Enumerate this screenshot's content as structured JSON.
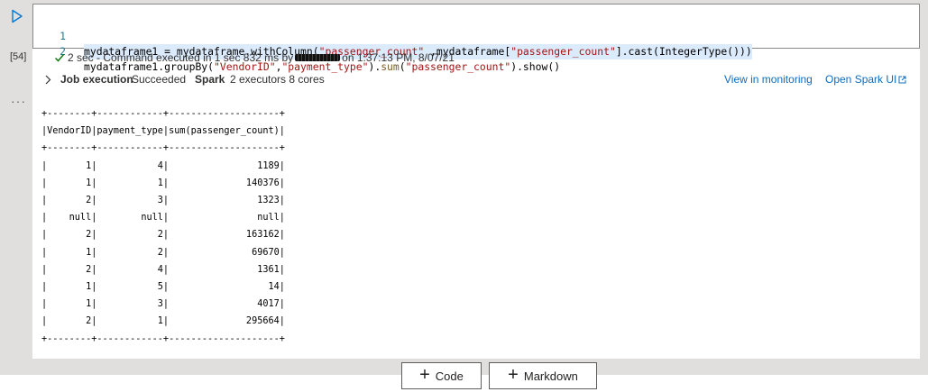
{
  "cell": {
    "execution_count": "[54]",
    "code_lines": [
      {
        "num": "1",
        "text": "mydataframe1 = mydataframe.withColumn(\"passenger_count\" ,mydataframe[\"passenger_count\"].cast(IntegerType()))"
      },
      {
        "num": "2",
        "text": "mydataframe1.groupBy(\"VendorID\",\"payment_type\").sum(\"passenger_count\").show()"
      }
    ],
    "status": {
      "duration": "2 sec",
      "message_before": "- Command executed in 1 sec 832 ms by",
      "message_after": "on 1:37:13 PM, 8/07/21"
    },
    "job": {
      "label": "Job execution",
      "result": "Succeeded",
      "spark_label": "Spark",
      "spark_info": "2 executors 8 cores",
      "view_monitoring": "View in monitoring",
      "open_spark_ui": "Open Spark UI"
    },
    "output_text": "+--------+------------+--------------------+\n|VendorID|payment_type|sum(passenger_count)|\n+--------+------------+--------------------+\n|       1|           4|                1189|\n|       1|           1|              140376|\n|       2|           3|                1323|\n|    null|        null|                null|\n|       2|           2|              163162|\n|       1|           2|               69670|\n|       2|           4|                1361|\n|       1|           5|                  14|\n|       1|           3|                4017|\n|       2|           1|              295664|\n+--------+------------+--------------------+"
  },
  "toolbar": {
    "add_code": "Code",
    "add_markdown": "Markdown"
  },
  "colors": {
    "accent": "#0078d4",
    "success": "#107c10",
    "link": "#0f6cbd",
    "panel": "#e1dfdd"
  }
}
